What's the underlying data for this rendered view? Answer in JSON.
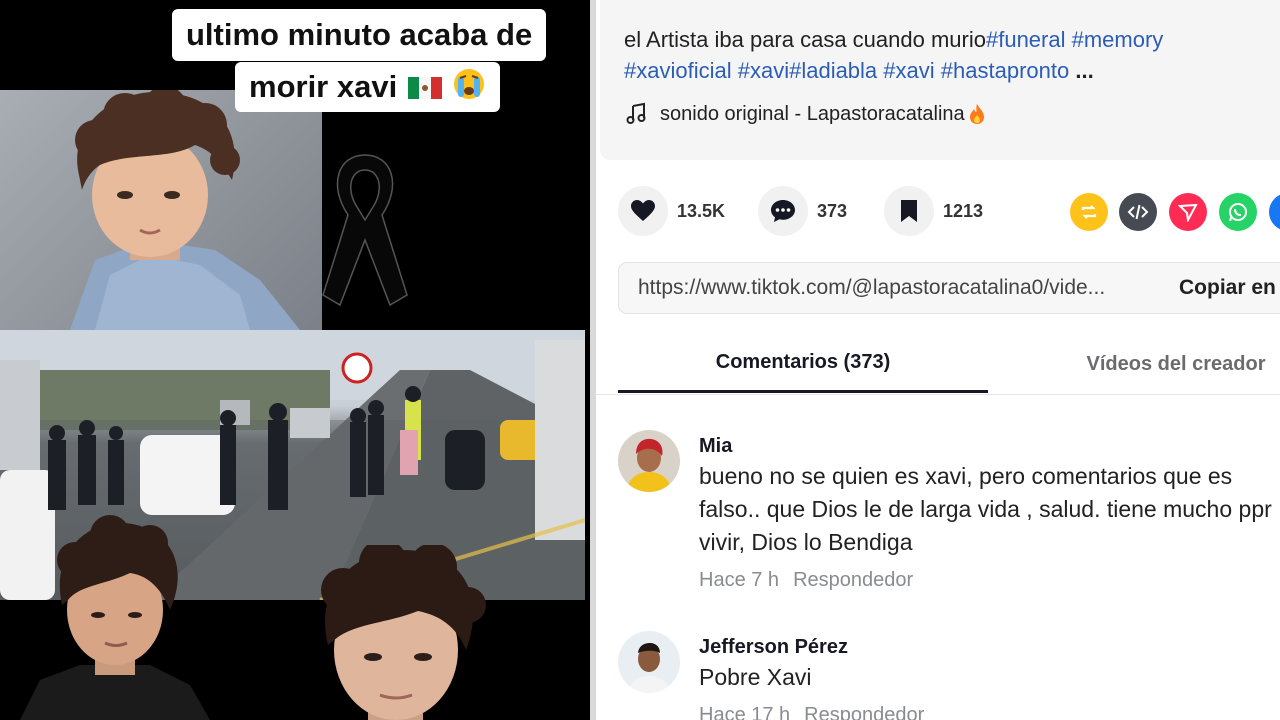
{
  "video": {
    "caption_line1": "ultimo minuto acaba de",
    "caption_line2": "morir xavi",
    "emoji_flag": "mexico-flag-icon",
    "emoji_face": "crying-face-icon",
    "ribbon_icon": "black-mourning-ribbon-icon"
  },
  "panel": {
    "description_text": "el Artista iba para casa cuando murio",
    "hashtags_line1": [
      "#funeral",
      "#memory"
    ],
    "hashtags_line2": [
      "#xavioficial",
      "#xavi",
      "#ladiabla",
      "#xavi",
      "#hastapronto"
    ],
    "more": "...",
    "sound": "sonido original - Lapastoracatalina",
    "actions": {
      "likes": "13.5K",
      "comments": "373",
      "saves": "1213"
    },
    "share_icons": [
      "repost-icon",
      "embed-icon",
      "send-icon",
      "whatsapp-icon",
      "facebook-icon"
    ],
    "link_url": "https://www.tiktok.com/@lapastoracatalina0/vide...",
    "copy_label": "Copiar en",
    "tabs": {
      "comments": "Comentarios (373)",
      "videos": "Vídeos del creador"
    },
    "comments": [
      {
        "user": "Mia",
        "text": "bueno no se quien es xavi, pero comentarios que es falso.. que Dios le de larga vida , salud. tiene mucho ppr vivir, Dios lo Bendiga",
        "time": "Hace 7 h",
        "reply": "Respondedor"
      },
      {
        "user": "Jefferson Pérez",
        "text": "Pobre Xavi",
        "time": "Hace 17 h",
        "reply": "Respondedor"
      }
    ]
  },
  "colors": {
    "hashtag": "#2b5db5",
    "repost": "#ffc21a",
    "embed": "#464b53",
    "send": "#fe2c55",
    "whatsapp": "#25d366",
    "facebook": "#1877f2"
  }
}
